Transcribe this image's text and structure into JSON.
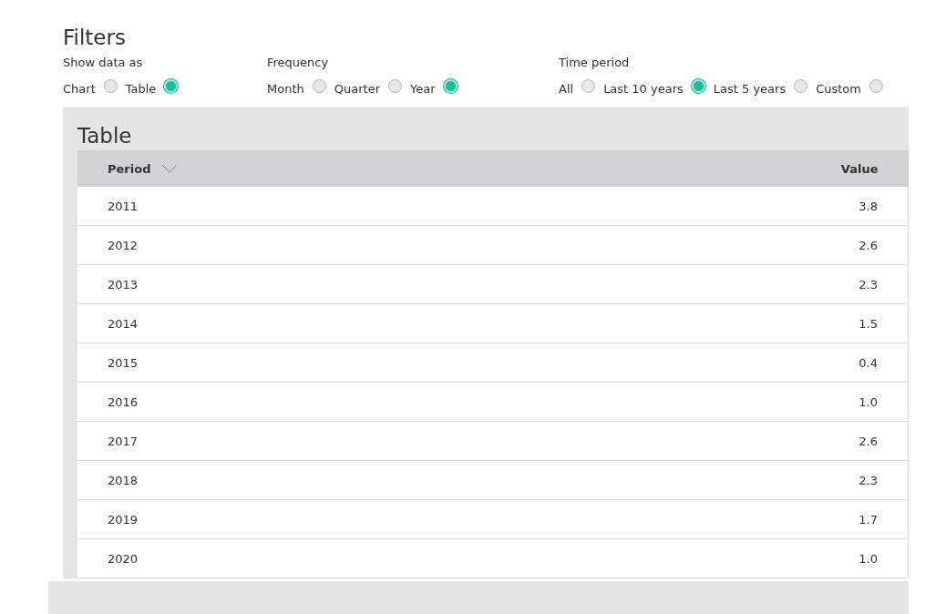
{
  "filters": {
    "title": "Filters",
    "groups": [
      {
        "label": "Show data as",
        "options": [
          {
            "label": "Chart",
            "selected": false
          },
          {
            "label": "Table",
            "selected": true
          }
        ]
      },
      {
        "label": "Frequency",
        "options": [
          {
            "label": "Month",
            "selected": false
          },
          {
            "label": "Quarter",
            "selected": false
          },
          {
            "label": "Year",
            "selected": true
          }
        ]
      },
      {
        "label": "Time period",
        "options": [
          {
            "label": "All",
            "selected": false
          },
          {
            "label": "Last 10 years",
            "selected": true
          },
          {
            "label": "Last 5 years",
            "selected": false
          },
          {
            "label": "Custom",
            "selected": false
          }
        ]
      }
    ]
  },
  "table": {
    "title": "Table",
    "columns": [
      "Period",
      "Value"
    ],
    "rows": [
      [
        "2011",
        "3.8"
      ],
      [
        "2012",
        "2.6"
      ],
      [
        "2013",
        "2.3"
      ],
      [
        "2014",
        "1.5"
      ],
      [
        "2015",
        "0.4"
      ],
      [
        "2016",
        "1.0"
      ],
      [
        "2017",
        "2.6"
      ],
      [
        "2018",
        "2.3"
      ],
      [
        "2019",
        "1.7"
      ],
      [
        "2020",
        "1.0"
      ]
    ]
  }
}
